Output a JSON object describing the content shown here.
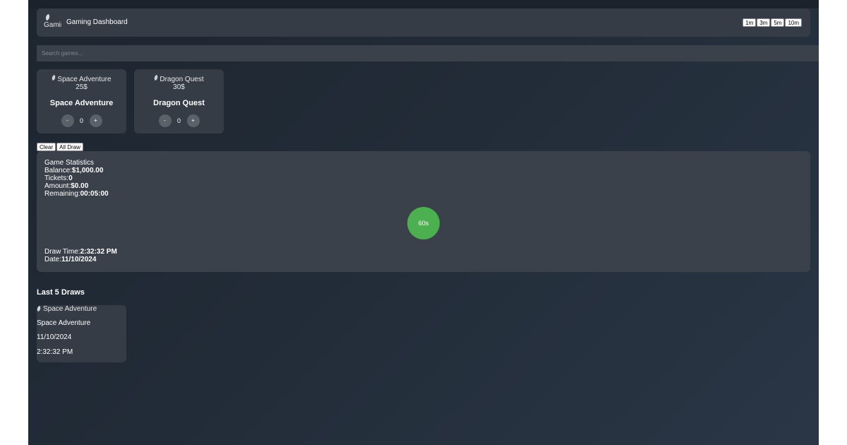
{
  "header": {
    "logo_alt": "Gaming",
    "title": "Gaming Dashboard",
    "intervals": [
      "1m",
      "3m",
      "5m",
      "10m"
    ]
  },
  "search": {
    "placeholder": "Search games...",
    "value": ""
  },
  "games": [
    {
      "image_alt": "Space Adventure",
      "price": "25$",
      "name": "Space Adventure",
      "dec_label": "-",
      "count": "0",
      "inc_label": "+"
    },
    {
      "image_alt": "Dragon Quest",
      "price": "30$",
      "name": "Dragon Quest",
      "dec_label": "-",
      "count": "0",
      "inc_label": "+"
    }
  ],
  "actions": {
    "clear_label": "Clear",
    "all_draw_label": "All Draw"
  },
  "stats": {
    "heading": "Game Statistics",
    "balance_label": "Balance:",
    "balance": "$1,000.00",
    "tickets_label": "Tickets:",
    "tickets": "0",
    "amount_label": "Amount:",
    "amount": "$0.00",
    "remaining_label": "Remaining:",
    "remaining": "00:05:00",
    "timer": "60s",
    "draw_time_label": "Draw Time:",
    "draw_time": "2:32:32 PM",
    "date_label": "Date:",
    "date": "11/10/2024"
  },
  "last_draws": {
    "title": "Last 5 Draws",
    "items": [
      {
        "image_alt": "Space Adventure",
        "name": "Space Adventure",
        "date": "11/10/2024",
        "time": "2:32:32 PM"
      }
    ]
  },
  "colors": {
    "accent": "#4caf50",
    "card": "#353c46",
    "panel": "#3a414b"
  }
}
